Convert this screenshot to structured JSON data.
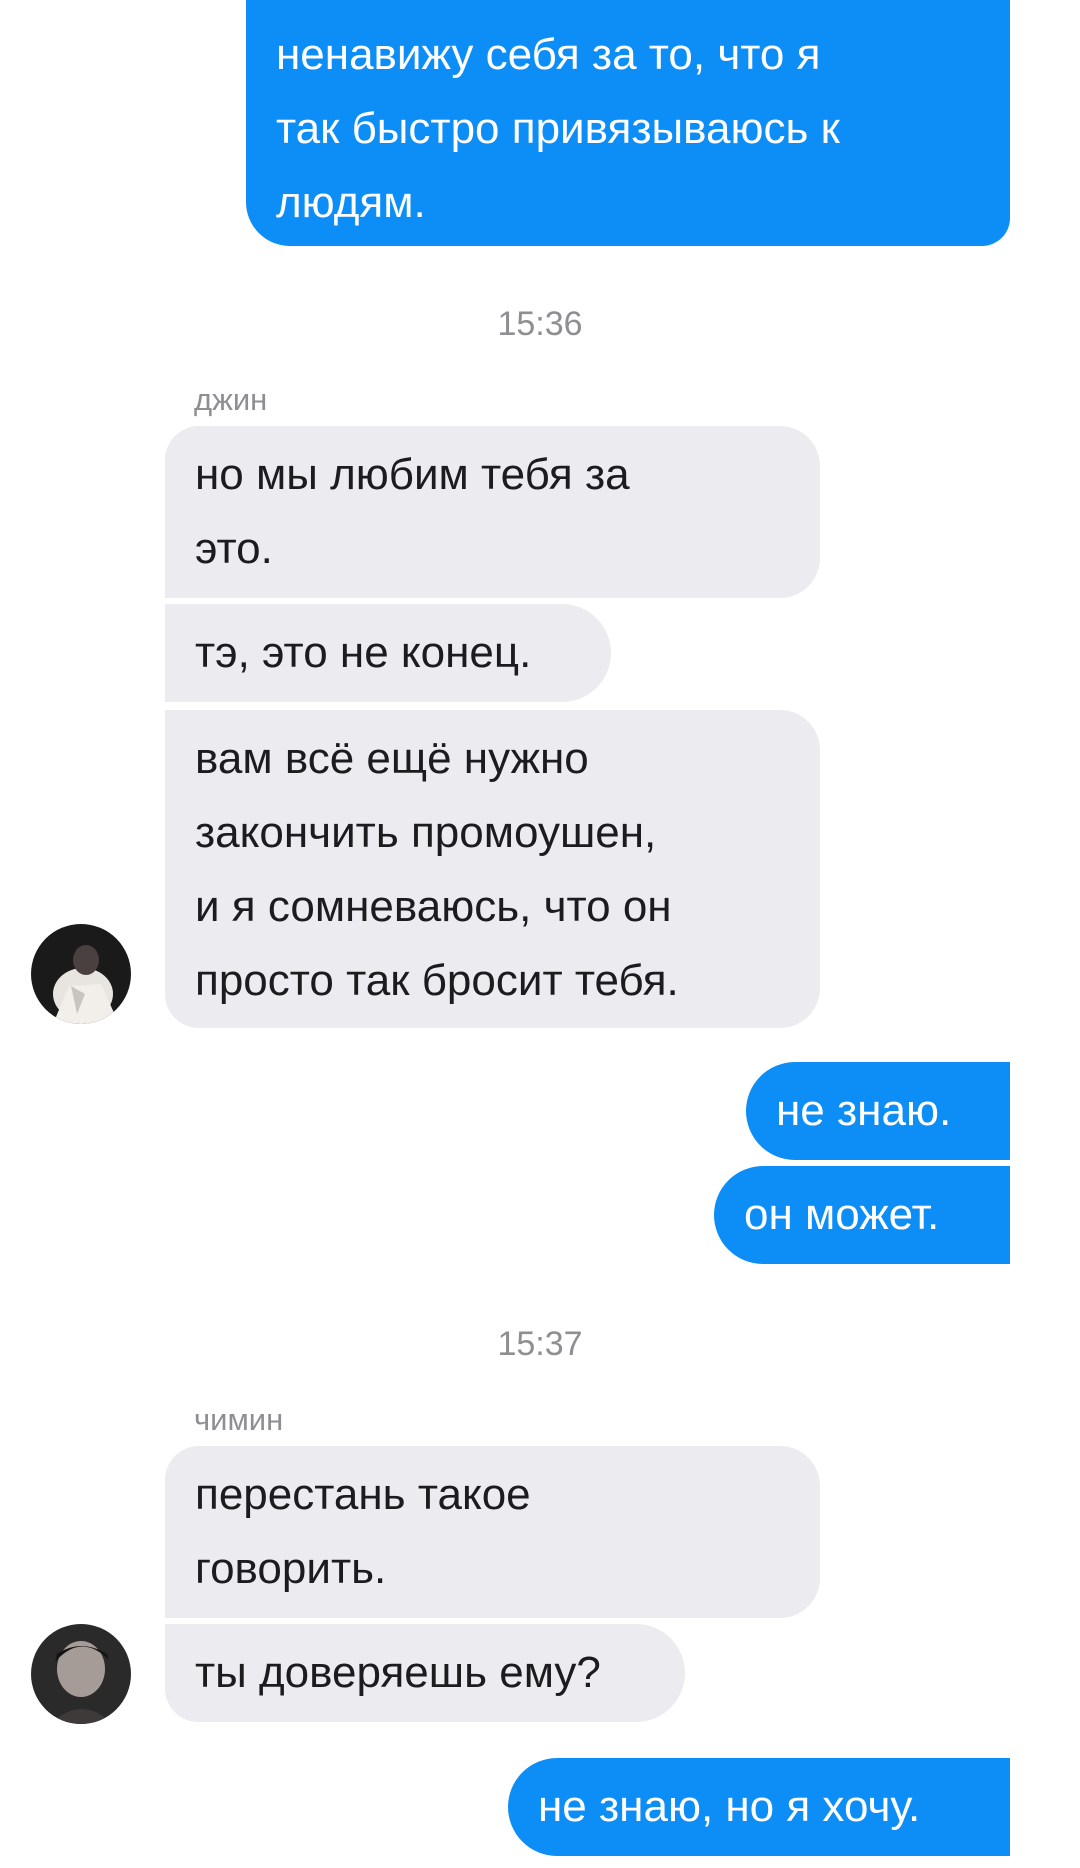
{
  "timestamps": [
    "15:36",
    "15:37"
  ],
  "senders": [
    "джин",
    "чимин"
  ],
  "messages": {
    "m1": "ненавижу себя за то, что я\nтак быстро привязываюсь к\nлюдям.",
    "m2": "но мы любим тебя за\nэто.",
    "m3": "тэ, это не конец.",
    "m4": "вам всё ещё нужно\nзакончить промоушен,\nи я сомневаюсь, что он\nпросто так бросит тебя.",
    "m5": "не знаю.",
    "m6": "он может.",
    "m7": "перестань такое\nговорить.",
    "m8": "ты доверяешь ему?",
    "m9": "не знаю, но я хочу."
  },
  "colors": {
    "outgoing_bubble": "#0d8ef7",
    "incoming_bubble": "#ebebf0",
    "meta_text": "#8e8e93"
  }
}
